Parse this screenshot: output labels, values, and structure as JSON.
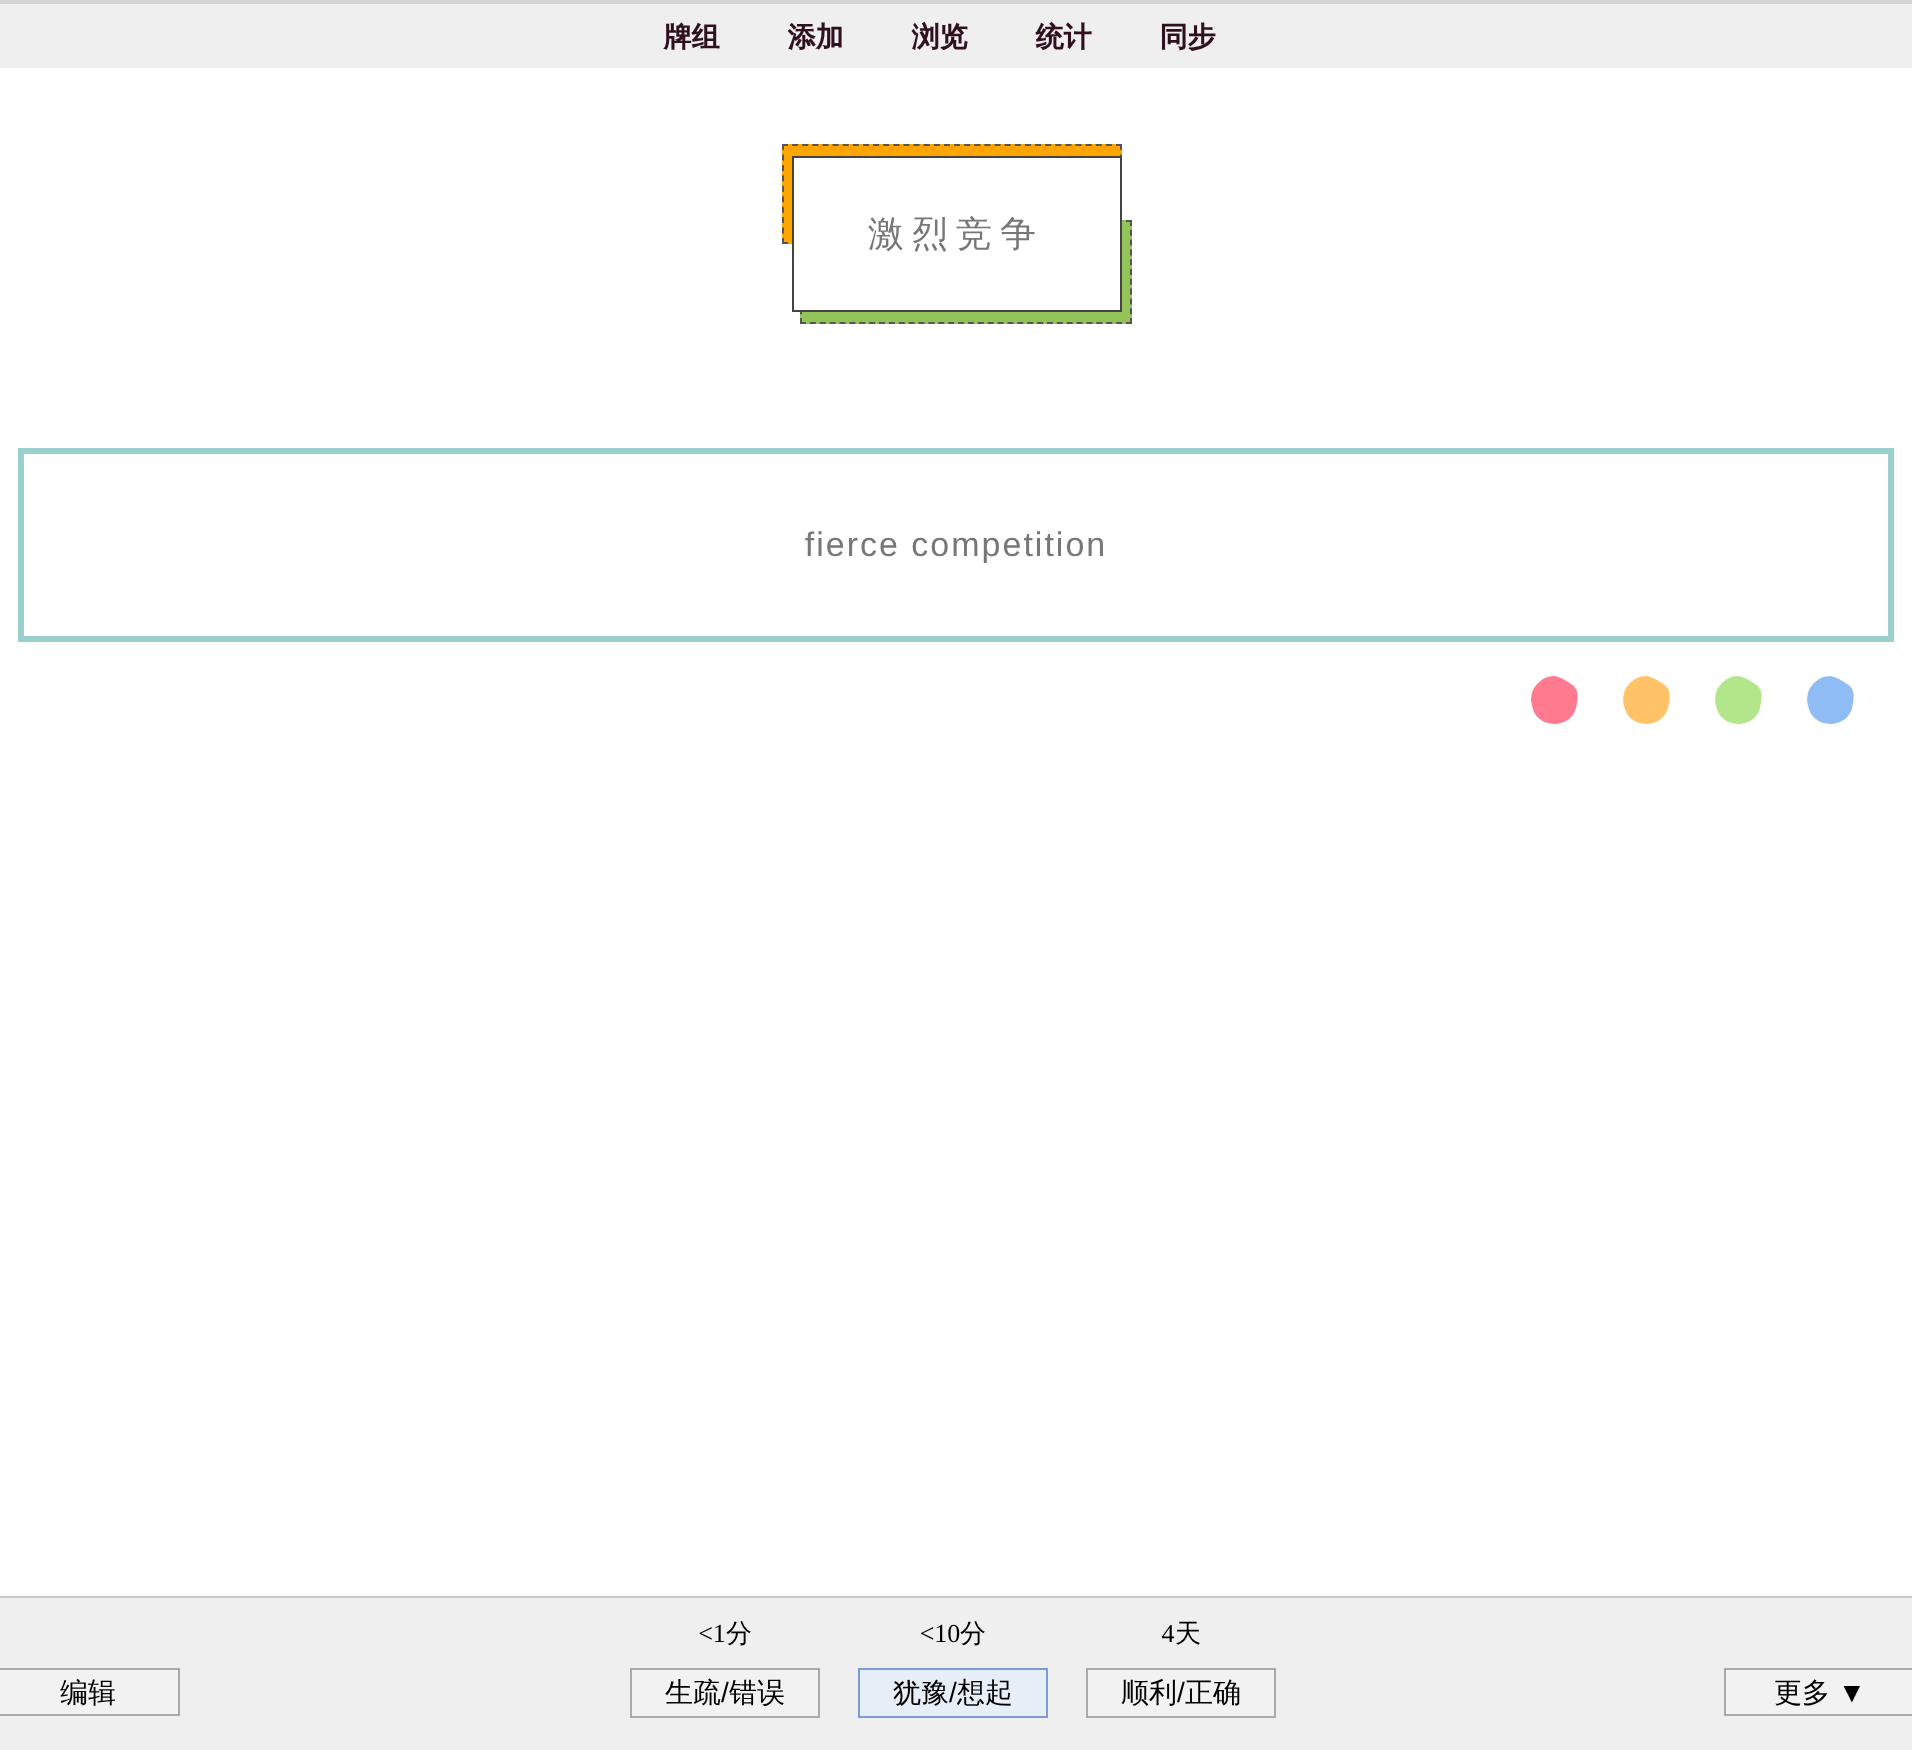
{
  "menu": [
    "牌组",
    "添加",
    "浏览",
    "统计",
    "同步"
  ],
  "card": {
    "front": "激烈竞争",
    "back": "fierce competition"
  },
  "flags": [
    {
      "color": "#ff7a8e"
    },
    {
      "color": "#ffc266"
    },
    {
      "color": "#b3e68a"
    },
    {
      "color": "#8fbcf5"
    }
  ],
  "bottom_bar": {
    "edit_button": "编辑",
    "answers": [
      {
        "interval": "<1分",
        "label": "生疏/错误",
        "selected": false
      },
      {
        "interval": "<10分",
        "label": "犹豫/想起",
        "selected": true
      },
      {
        "interval": "4天",
        "label": "顺利/正确",
        "selected": false
      }
    ],
    "more_button": "更多 ▼"
  }
}
